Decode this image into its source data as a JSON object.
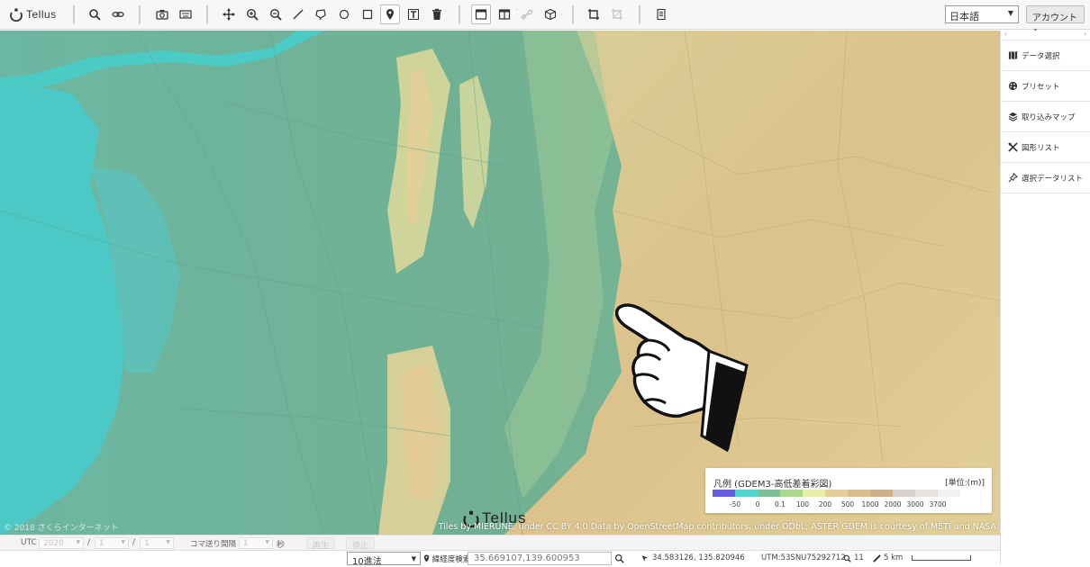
{
  "app": {
    "logo_text": "Tellus"
  },
  "toolbar": {
    "tools": [
      {
        "name": "search-icon",
        "active": false
      },
      {
        "name": "link-icon",
        "active": false
      },
      {
        "name": "camera-icon",
        "active": false
      },
      {
        "name": "keyboard-icon",
        "active": false
      },
      {
        "name": "move-icon",
        "active": false
      },
      {
        "name": "zoom-in-icon",
        "active": false
      },
      {
        "name": "zoom-out-icon",
        "active": false
      },
      {
        "name": "line-icon",
        "active": false
      },
      {
        "name": "lasso-icon",
        "active": false
      },
      {
        "name": "circle-icon",
        "active": false
      },
      {
        "name": "rectangle-icon",
        "active": false
      },
      {
        "name": "pin-icon",
        "active": true
      },
      {
        "name": "text-icon",
        "active": false
      },
      {
        "name": "trash-icon",
        "active": false
      },
      {
        "name": "single-window-icon",
        "active": true
      },
      {
        "name": "split-window-icon",
        "active": false
      },
      {
        "name": "sync-link-icon",
        "active": false
      },
      {
        "name": "cube-icon",
        "active": false
      },
      {
        "name": "crop-icon",
        "active": false
      },
      {
        "name": "crop-disabled-icon",
        "active": false
      },
      {
        "name": "document-icon",
        "active": false
      }
    ],
    "language": "日本語",
    "account_label": "アカウント",
    "account_caret": "⌄"
  },
  "side_panel": {
    "collapse_left": "‹",
    "collapse_right": "›",
    "items": [
      {
        "label": "データ選択",
        "icon": "map-icon"
      },
      {
        "label": "プリセット",
        "icon": "palette-icon"
      },
      {
        "label": "取り込みマップ",
        "icon": "layers-icon"
      },
      {
        "label": "図形リスト",
        "icon": "shapes-icon"
      },
      {
        "label": "選択データリスト",
        "icon": "pin-list-icon"
      }
    ]
  },
  "map": {
    "copyright_left": "© 2018 さくらインターネット",
    "attribution": "Tiles by MIERUNE, under CC BY 4.0 Data by OpenStreetMap contributors, under ODbL, ASTER GDEM is courtesy of METI and NASA",
    "watermark": "Tellus"
  },
  "legend": {
    "title": "凡例 (GDEM3-高低差着彩図)",
    "unit": "[単位:(m)]",
    "colors": [
      "#6a5ee0",
      "#54d6d0",
      "#7ebf97",
      "#a9d98c",
      "#e9eea6",
      "#e2cf9c",
      "#dcbe8c",
      "#cfb08b",
      "#d6d1cc",
      "#e6e3df",
      "#f4f2f0"
    ],
    "ticks": [
      "-50",
      "0",
      "0.1",
      "100",
      "200",
      "500",
      "1000",
      "2000",
      "3000",
      "3700"
    ]
  },
  "time_bar": {
    "utc_label": "UTC",
    "year": "2020",
    "month": "1",
    "day": "1",
    "slash": "/",
    "frame_interval_label": "コマ送り間隔",
    "interval_value": "1",
    "seconds_label": "秒",
    "play_label": "再生",
    "stop_label": "停止"
  },
  "status_bar": {
    "notation": "10進法",
    "coord_search_label": "緯経度検索",
    "coord_input_value": "35.669107,139.600953",
    "cursor_coords": "34.583126, 135.820946",
    "utm": "UTM:53SNU75292712",
    "zoom": "11",
    "scale": "5 km"
  }
}
